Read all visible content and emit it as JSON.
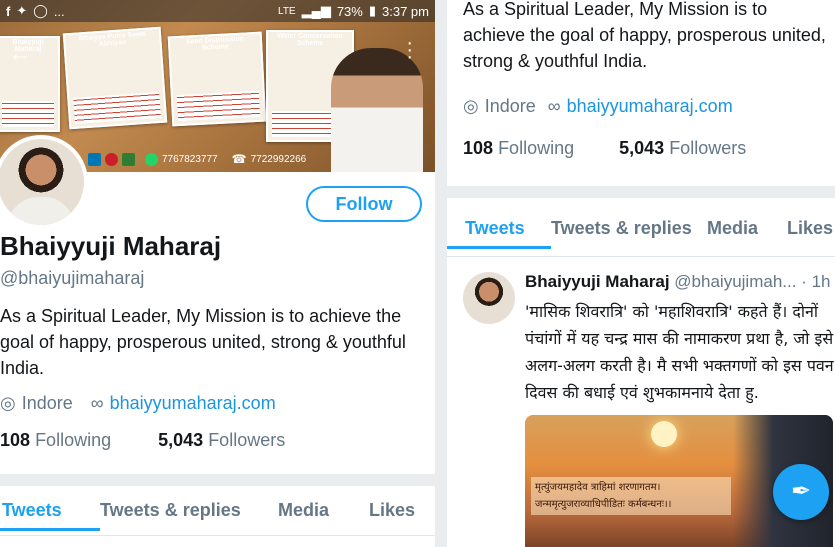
{
  "status": {
    "lte": "LTE",
    "battery": "73%",
    "time": "3:37 pm",
    "ellipsis": "..."
  },
  "banner": {
    "card_headers": [
      "Bhaiyyuji Maharaj",
      "Bhaiyya Putra Sewa Abhiyan",
      "Seed Distribution Scheme",
      "Water Conservation Scheme"
    ],
    "phone_1": "7767823777",
    "phone_2": "7722992266"
  },
  "profile": {
    "follow_label": "Follow",
    "name": "Bhaiyyuji Maharaj",
    "handle": "@bhaiyujimaharaj",
    "bio": "As a Spiritual Leader, My Mission is to achieve the goal of happy, prosperous united, strong & youthful India.",
    "location": "Indore",
    "website": "bhaiyyumaharaj.com",
    "following_count": "108",
    "following_label": "Following",
    "followers_count": "5,043",
    "followers_label": "Followers"
  },
  "tabs": [
    {
      "label": "Tweets"
    },
    {
      "label": "Tweets & replies"
    },
    {
      "label": "Media"
    },
    {
      "label": "Likes"
    }
  ],
  "tweet": {
    "author": "Bhaiyyuji Maharaj",
    "handle": "@bhaiyujimah...",
    "time": "· 1h",
    "text": "'मासिक शिवरात्रि' को 'महाशिवरात्रि' कहते हैं। दोनों पंचांगों में यह चन्द्र मास की नामाकरण प्रथा है, जो इसे अलग-अलग करती है। मै सभी भक्तगणों को इस पवन दिवस की बधाई एवं शुभकामनाये देता हु.",
    "image_text": "मृत्युंजयमहादेव त्राहिमां शरणागतम। जन्ममृत्युजराव्याधिपीडितः कर्मबन्धनः।।"
  },
  "colors": {
    "accent": "#1da1f2",
    "link": "#1b95e0",
    "muted": "#657786"
  }
}
